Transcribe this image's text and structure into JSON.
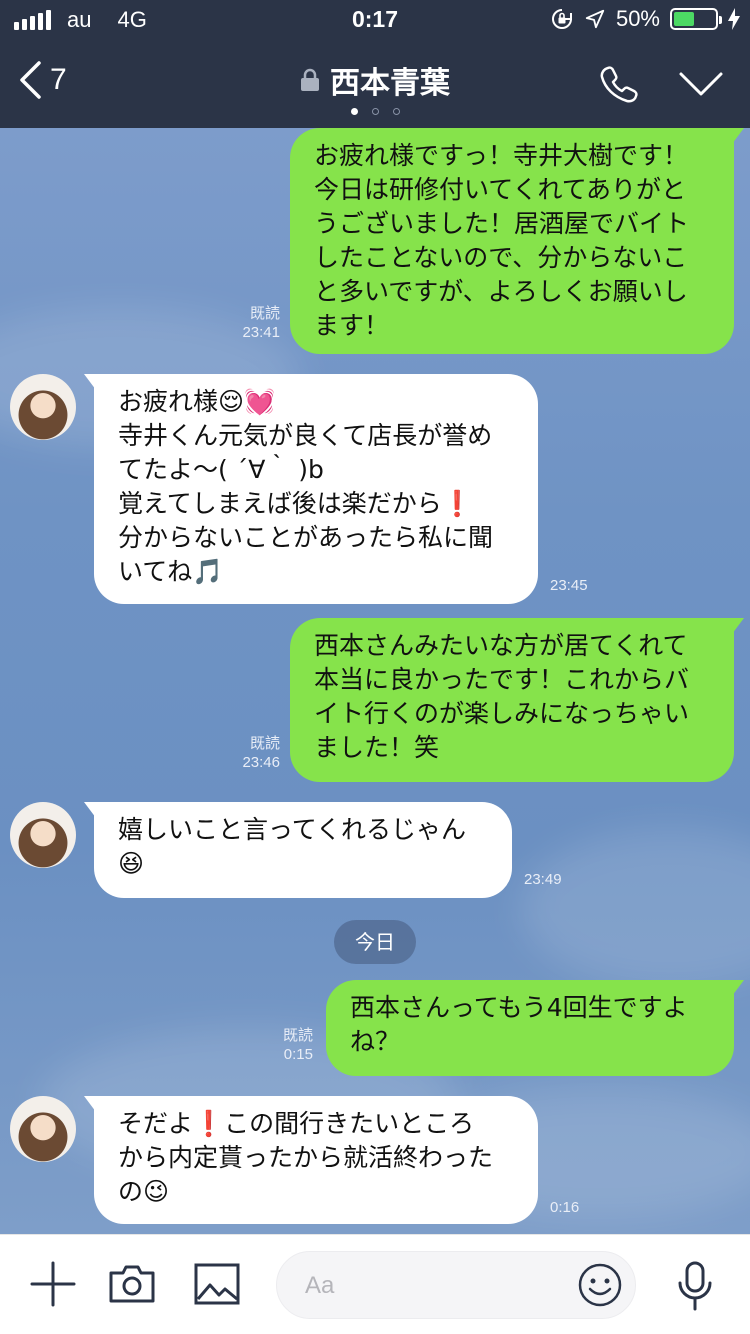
{
  "status_bar": {
    "carrier": "au",
    "network": "4G",
    "time": "0:17",
    "battery": "50%",
    "battery_level": 0.5
  },
  "header": {
    "back_count": "7",
    "title": "西本青葉",
    "page_dots": 3,
    "active_dot": 0
  },
  "messages": [
    {
      "side": "out",
      "lines": [
        "お疲れ様ですっ！寺井大樹です！",
        "今日は研修付いてくれてありがと",
        "うございました！居酒屋でバイト",
        "したことないので、分からないこ",
        "と多いですが、よろしくお願いし",
        "ます！"
      ],
      "read": "既読",
      "time": "23:41"
    },
    {
      "side": "in",
      "lines": [
        "お疲れ様😌💓",
        "寺井くん元気が良くて店長が誉め",
        "てたよ〜( ´∀｀ )b",
        "覚えてしまえば後は楽だから❗️",
        "分からないことがあったら私に聞",
        "いてね🎵"
      ],
      "time": "23:45"
    },
    {
      "side": "out",
      "lines": [
        "西本さんみたいな方が居てくれて",
        "本当に良かったです！これからバ",
        "イト行くのが楽しみになっちゃい",
        "ました！笑"
      ],
      "read": "既読",
      "time": "23:46"
    },
    {
      "side": "in",
      "lines": [
        "嬉しいこと言ってくれるじゃん",
        "😆"
      ],
      "time": "23:49"
    },
    {
      "date_divider": "今日"
    },
    {
      "side": "out",
      "lines": [
        "西本さんってもう4回生ですよ",
        "ね？"
      ],
      "read": "既読",
      "time": "0:15"
    },
    {
      "side": "in",
      "lines": [
        "そだよ❗️この間行きたいところ",
        "から内定貰ったから就活終わった",
        "の😉"
      ],
      "time": "0:16"
    }
  ],
  "input_bar": {
    "placeholder": "Aa"
  },
  "colors": {
    "header_bg": "#2b3447",
    "outgoing_bubble": "#86e34b",
    "incoming_bubble": "#ffffff",
    "chat_bg": "#6f93c3"
  }
}
